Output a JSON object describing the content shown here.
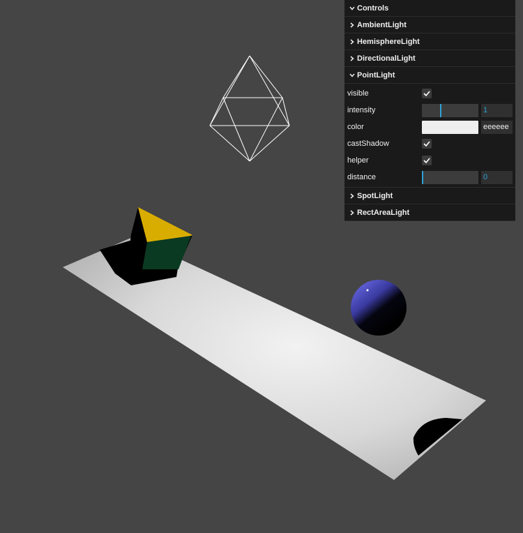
{
  "scene": {
    "background": "#454545",
    "floor_color": "#eeeeee",
    "cube_top_color": "#e8b800",
    "cube_side_color": "#0a3a22",
    "sphere_color": "#4040b0",
    "helper_color": "#ffffff"
  },
  "controls": {
    "title": "Controls",
    "folders": {
      "ambient": "AmbientLight",
      "hemisphere": "HemisphereLight",
      "directional": "DirectionalLight",
      "point": "PointLight",
      "spot": "SpotLight",
      "rectarea": "RectAreaLight"
    },
    "point_props": {
      "visible_label": "visible",
      "visible": true,
      "intensity_label": "intensity",
      "intensity_value": "1",
      "intensity_fraction": 0.33,
      "color_label": "color",
      "color_value": "eeeeee",
      "cast_shadow_label": "castShadow",
      "cast_shadow": true,
      "helper_label": "helper",
      "helper": true,
      "distance_label": "distance",
      "distance_value": "0",
      "distance_fraction": 0
    },
    "icons": {
      "collapsed": "chevron-right-icon",
      "expanded": "chevron-down-icon",
      "check": "checkmark-icon"
    },
    "accent_color": "#2fa1d6"
  }
}
